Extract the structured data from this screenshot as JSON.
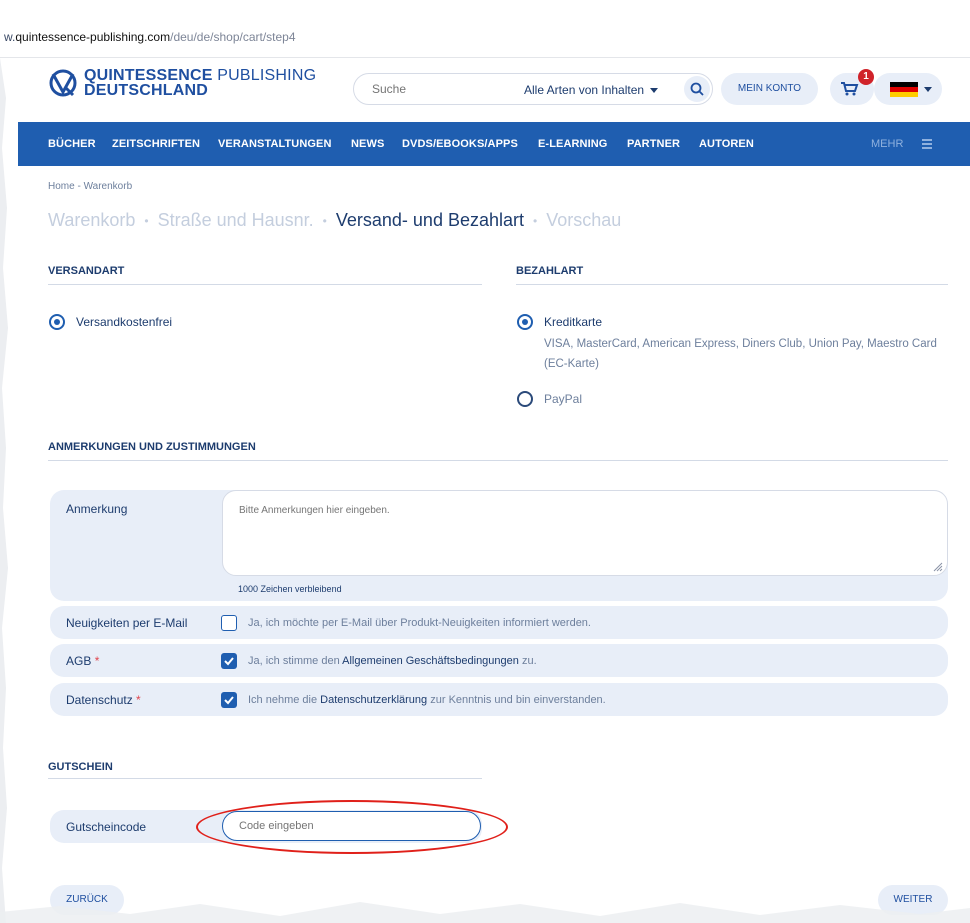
{
  "browser": {
    "url_prefix": "w.",
    "url_host": "quintessence-publishing.com",
    "url_path": "/deu/de/shop/cart/step4"
  },
  "header": {
    "logo_line1_bold": "QUINTESSENCE",
    "logo_line1_light": " PUBLISHING",
    "logo_line2": "DEUTSCHLAND",
    "search_placeholder": "Suche",
    "search_type": "Alle Arten von Inhalten",
    "account_label": "MEIN KONTO",
    "cart_count": "1",
    "flag_colors": [
      "#000000",
      "#dd0000",
      "#ffce00"
    ]
  },
  "nav": {
    "items": [
      "BÜCHER",
      "ZEITSCHRIFTEN",
      "VERANSTALTUNGEN",
      "NEWS",
      "DVDS/EBOOKS/APPS",
      "E-LEARNING",
      "PARTNER",
      "AUTOREN"
    ],
    "more_label": "MEHR"
  },
  "breadcrumb": {
    "home": "Home",
    "sep": "-",
    "current": "Warenkorb"
  },
  "steps": {
    "items": [
      "Warenkorb",
      "Straße und Hausnr.",
      "Versand- und Bezahlart",
      "Vorschau"
    ],
    "separator": "•",
    "active_index": 2
  },
  "shipping": {
    "title": "VERSANDART",
    "options": [
      {
        "label": "Versandkostenfrei",
        "selected": true
      }
    ]
  },
  "payment": {
    "title": "BEZAHLART",
    "options": [
      {
        "label": "Kreditkarte",
        "selected": true,
        "desc_line1": "VISA, MasterCard, American Express, Diners Club, Union Pay, Maestro Card",
        "desc_line2": "(EC-Karte)"
      },
      {
        "label": "PayPal",
        "selected": false
      }
    ]
  },
  "remarks": {
    "title": "ANMERKUNGEN UND ZUSTIMMUNGEN",
    "remark_label": "Anmerkung",
    "remark_placeholder": "Bitte Anmerkungen hier eingeben.",
    "char_count": "1000 Zeichen verbleibend",
    "newsletter_label": "Neuigkeiten per E-Mail",
    "newsletter_text": "Ja, ich möchte per E-Mail über Produkt-Neuigkeiten informiert werden.",
    "newsletter_checked": false,
    "agb_label": "AGB",
    "agb_text_pre": "Ja, ich stimme den ",
    "agb_link": "Allgemeinen Geschäftsbedingungen",
    "agb_text_post": " zu.",
    "agb_checked": true,
    "privacy_label": "Datenschutz",
    "privacy_text_pre": "Ich nehme die ",
    "privacy_link": "Datenschutzerklärung",
    "privacy_text_post": " zur Kenntnis und bin einverstanden.",
    "privacy_checked": true,
    "required_mark": "*"
  },
  "voucher": {
    "title": "GUTSCHEIN",
    "label": "Gutscheincode",
    "placeholder": "Code eingeben",
    "highlight_color": "#e0201a"
  },
  "footer": {
    "back_label": "ZURÜCK",
    "next_label": "WEITER"
  },
  "colors": {
    "primary": "#1f5eb0",
    "text": "#1d3c6e",
    "panel": "#e8eef8",
    "badge": "#d0232a"
  }
}
